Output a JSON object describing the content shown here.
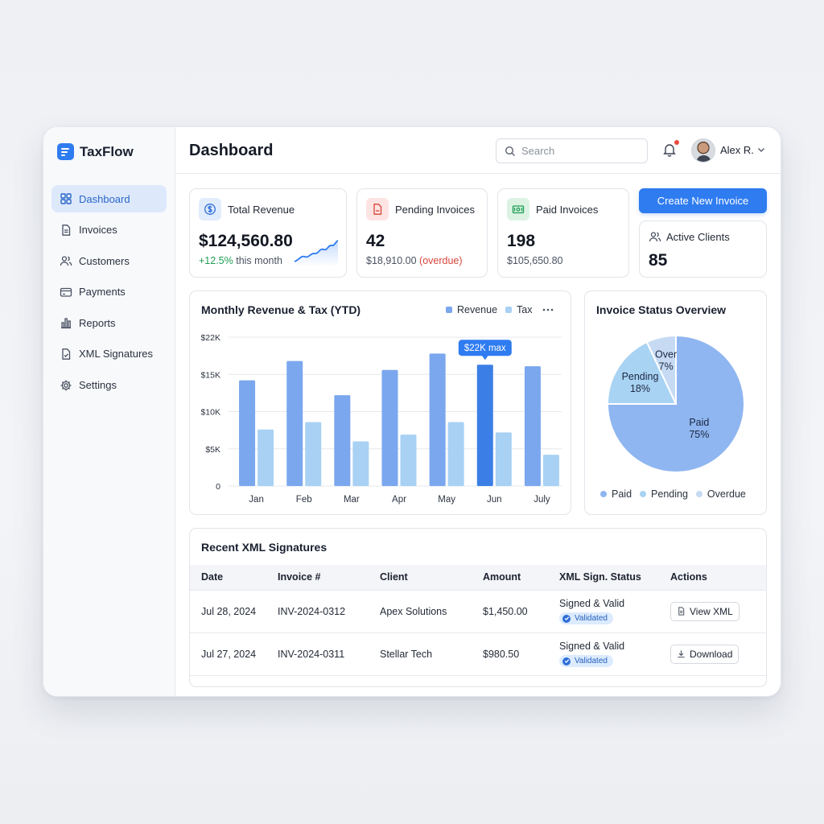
{
  "brand": {
    "name": "TaxFlow"
  },
  "sidebar": {
    "items": [
      {
        "label": "Dashboard",
        "icon": "dashboard-icon",
        "active": true
      },
      {
        "label": "Invoices",
        "icon": "document-icon"
      },
      {
        "label": "Customers",
        "icon": "users-icon"
      },
      {
        "label": "Payments",
        "icon": "card-icon"
      },
      {
        "label": "Reports",
        "icon": "bar-chart-icon"
      },
      {
        "label": "XML Signatures",
        "icon": "signed-document-icon"
      },
      {
        "label": "Settings",
        "icon": "gear-icon"
      }
    ]
  },
  "header": {
    "title": "Dashboard",
    "search_placeholder": "Search",
    "user_name": "Alex R."
  },
  "stats": {
    "total_revenue": {
      "label": "Total Revenue",
      "value": "$124,560.80",
      "change": "+12.5%",
      "change_suffix": "this month"
    },
    "pending": {
      "label": "Pending Invoices",
      "value": "42",
      "amount": "$18,910.00",
      "note": "(overdue)"
    },
    "paid": {
      "label": "Paid Invoices",
      "value": "198",
      "amount": "$105,650.80"
    },
    "clients": {
      "label": "Active Clients",
      "value": "85"
    },
    "create_button": "Create New Invoice"
  },
  "colors": {
    "accent": "#2f7cf0",
    "revenue": "#7aa7ee",
    "revenue_highlight": "#3b7fe6",
    "tax": "#a8d1f4",
    "paid": "#8fb6f0",
    "pending": "#a9d3f3",
    "overdue": "#c6dbf3"
  },
  "chart_data": [
    {
      "type": "bar",
      "title": "Monthly Revenue & Tax (YTD)",
      "categories": [
        "Jan",
        "Feb",
        "Mar",
        "Apr",
        "May",
        "Jun",
        "July"
      ],
      "series": [
        {
          "name": "Revenue",
          "values": [
            14200,
            16800,
            12200,
            15600,
            17800,
            16300,
            16100
          ]
        },
        {
          "name": "Tax",
          "values": [
            7600,
            8600,
            6000,
            6900,
            8600,
            7200,
            4200
          ]
        }
      ],
      "yticks": [
        "0",
        "$5K",
        "$10K",
        "$15K",
        "$22K"
      ],
      "ytick_values": [
        0,
        5000,
        10000,
        15000,
        20000
      ],
      "ylim": [
        0,
        20000
      ],
      "annotation": {
        "text": "$22K max",
        "category": "Jun"
      },
      "highlight_category": "Jun",
      "grid": true,
      "legend": "top-right"
    },
    {
      "type": "pie",
      "title": "Invoice Status Overview",
      "slices": [
        {
          "name": "Paid",
          "label": "Paid",
          "percent_label": "75%",
          "value": 75
        },
        {
          "name": "Pending",
          "label": "Pending",
          "percent_label": "18%",
          "value": 18
        },
        {
          "name": "Overdue",
          "label": "Over",
          "percent_label": "7%",
          "value": 7
        }
      ],
      "legend": "bottom"
    }
  ],
  "signatures_table": {
    "title": "Recent XML Signatures",
    "columns": [
      "Date",
      "Invoice #",
      "Client",
      "Amount",
      "XML Sign. Status",
      "Actions"
    ],
    "rows": [
      {
        "date": "Jul 28, 2024",
        "invoice": "INV-2024-0312",
        "client": "Apex Solutions",
        "amount": "$1,450.00",
        "status": "Signed & Valid",
        "badge": "Validated",
        "action": "View XML",
        "action_icon": "document-icon"
      },
      {
        "date": "Jul 27, 2024",
        "invoice": "INV-2024-0311",
        "client": "Stellar Tech",
        "amount": "$980.50",
        "status": "Signed & Valid",
        "badge": "Validated",
        "action": "Download",
        "action_icon": "download-icon"
      }
    ]
  }
}
